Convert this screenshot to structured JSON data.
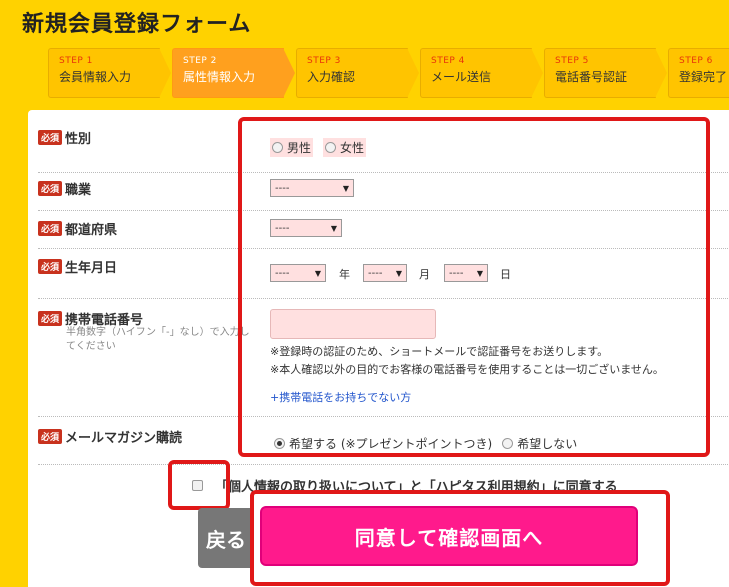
{
  "header": {
    "title": "新規会員登録フォーム"
  },
  "steps": [
    {
      "num": "STEP 1",
      "label": "会員情報入力",
      "active": false
    },
    {
      "num": "STEP 2",
      "label": "属性情報入力",
      "active": true
    },
    {
      "num": "STEP 3",
      "label": "入力確認",
      "active": false
    },
    {
      "num": "STEP 4",
      "label": "メール送信",
      "active": false
    },
    {
      "num": "STEP 5",
      "label": "電話番号認証",
      "active": false
    },
    {
      "num": "STEP 6",
      "label": "登録完了",
      "active": false
    }
  ],
  "required_badge": "必須",
  "form": {
    "gender": {
      "label": "性別",
      "options": [
        "男性",
        "女性"
      ]
    },
    "occupation": {
      "label": "職業",
      "value": "----"
    },
    "prefecture": {
      "label": "都道府県",
      "value": "----"
    },
    "birthday": {
      "label": "生年月日",
      "year": "----",
      "month": "----",
      "day": "----",
      "year_unit": "年",
      "month_unit": "月",
      "day_unit": "日"
    },
    "mobile": {
      "label": "携帯電話番号",
      "sublabel": "半角数字（ハイフン「-」なし）で入力してください",
      "value": "",
      "note1": "※登録時の認証のため、ショートメールで認証番号をお送りします。",
      "note2": "※本人確認以外の目的でお客様の電話番号を使用することは一切ございません。",
      "link": "+携帯電話をお持ちでない方"
    },
    "newsletter": {
      "label": "メールマガジン購読",
      "option_yes": "希望する (※プレゼントポイントつき)",
      "option_no": "希望しない"
    }
  },
  "agreement": {
    "text": "「個人情報の取り扱いについて」と「ハピタス利用規約」に同意する"
  },
  "buttons": {
    "back": "戻る",
    "confirm": "同意して確認画面へ"
  },
  "colors": {
    "background": "#ffd200",
    "accent": "#ff1a8c",
    "highlight": "#e01818"
  }
}
